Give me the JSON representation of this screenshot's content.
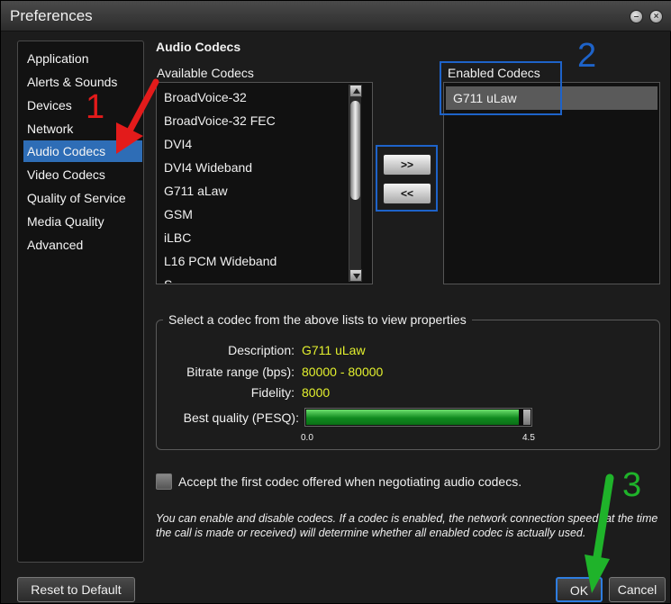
{
  "window": {
    "title": "Preferences"
  },
  "sidebar": {
    "items": [
      {
        "label": "Application",
        "active": false
      },
      {
        "label": "Alerts & Sounds",
        "active": false
      },
      {
        "label": "Devices",
        "active": false
      },
      {
        "label": "Network",
        "active": false
      },
      {
        "label": "Audio Codecs",
        "active": true
      },
      {
        "label": "Video Codecs",
        "active": false
      },
      {
        "label": "Quality of Service",
        "active": false
      },
      {
        "label": "Media Quality",
        "active": false
      },
      {
        "label": "Advanced",
        "active": false
      }
    ]
  },
  "main": {
    "section_title": "Audio Codecs",
    "available": {
      "label": "Available Codecs",
      "items": [
        "BroadVoice-32",
        "BroadVoice-32 FEC",
        "DVI4",
        "DVI4 Wideband",
        "G711 aLaw",
        "GSM",
        "iLBC",
        "L16 PCM Wideband",
        "S"
      ]
    },
    "enabled": {
      "label": "Enabled Codecs",
      "items": [
        "G711 uLaw"
      ]
    },
    "buttons": {
      "add": ">>",
      "remove": "<<"
    },
    "properties": {
      "legend": "Select a codec from the above lists to view properties",
      "description_label": "Description:",
      "description_value": "G711 uLaw",
      "bitrate_label": "Bitrate range (bps):",
      "bitrate_value": "80000 - 80000",
      "fidelity_label": "Fidelity:",
      "fidelity_value": "8000",
      "quality_label": "Best quality (PESQ):",
      "quality_value": 4.4,
      "quality_min": "0.0",
      "quality_max": "4.5"
    },
    "accept_first_codec": {
      "label": "Accept the first codec offered when negotiating audio codecs.",
      "checked": false
    },
    "note": "You can enable and disable codecs. If a codec is enabled, the network connection speed (at the time the call is made or received) will determine whether all enabled codec is actually used."
  },
  "footer": {
    "reset_label": "Reset to Default",
    "ok_label": "OK",
    "cancel_label": "Cancel"
  },
  "annotations": {
    "one": "1",
    "two": "2",
    "three": "3",
    "red": "#e31b1b",
    "blue": "#1e63c9",
    "green": "#1fb32a"
  }
}
